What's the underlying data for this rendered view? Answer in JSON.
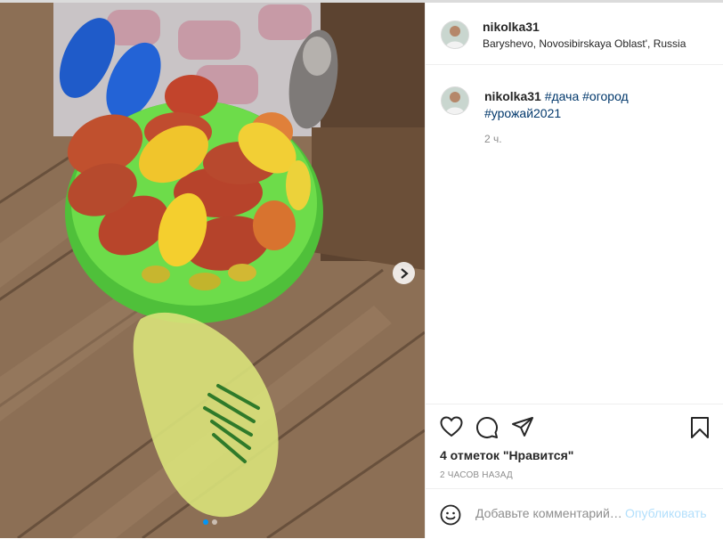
{
  "post": {
    "username": "nikolka31",
    "location": "Baryshevo, Novosibirskaya Oblast', Russia",
    "caption": {
      "username": "nikolka31",
      "hashtags": [
        "#дача",
        "#огород",
        "#урожай2021"
      ]
    },
    "time_ago": "2 ч.",
    "likes": "4 отметок \"Нравится\"",
    "posted_ago": "2 ЧАСОВ НАЗАД"
  },
  "comment": {
    "placeholder": "Добавьте комментарий…",
    "publish_label": "Опубликовать"
  },
  "carousel": {
    "current": 1,
    "total": 2
  },
  "icons": {
    "like": "heart-icon",
    "comment": "comment-icon",
    "share": "share-icon",
    "save": "bookmark-icon",
    "emoji": "smiley-icon",
    "next": "chevron-right-icon"
  },
  "colors": {
    "link": "#00376b",
    "accent": "#0095f6",
    "muted": "#8e8e8e"
  }
}
